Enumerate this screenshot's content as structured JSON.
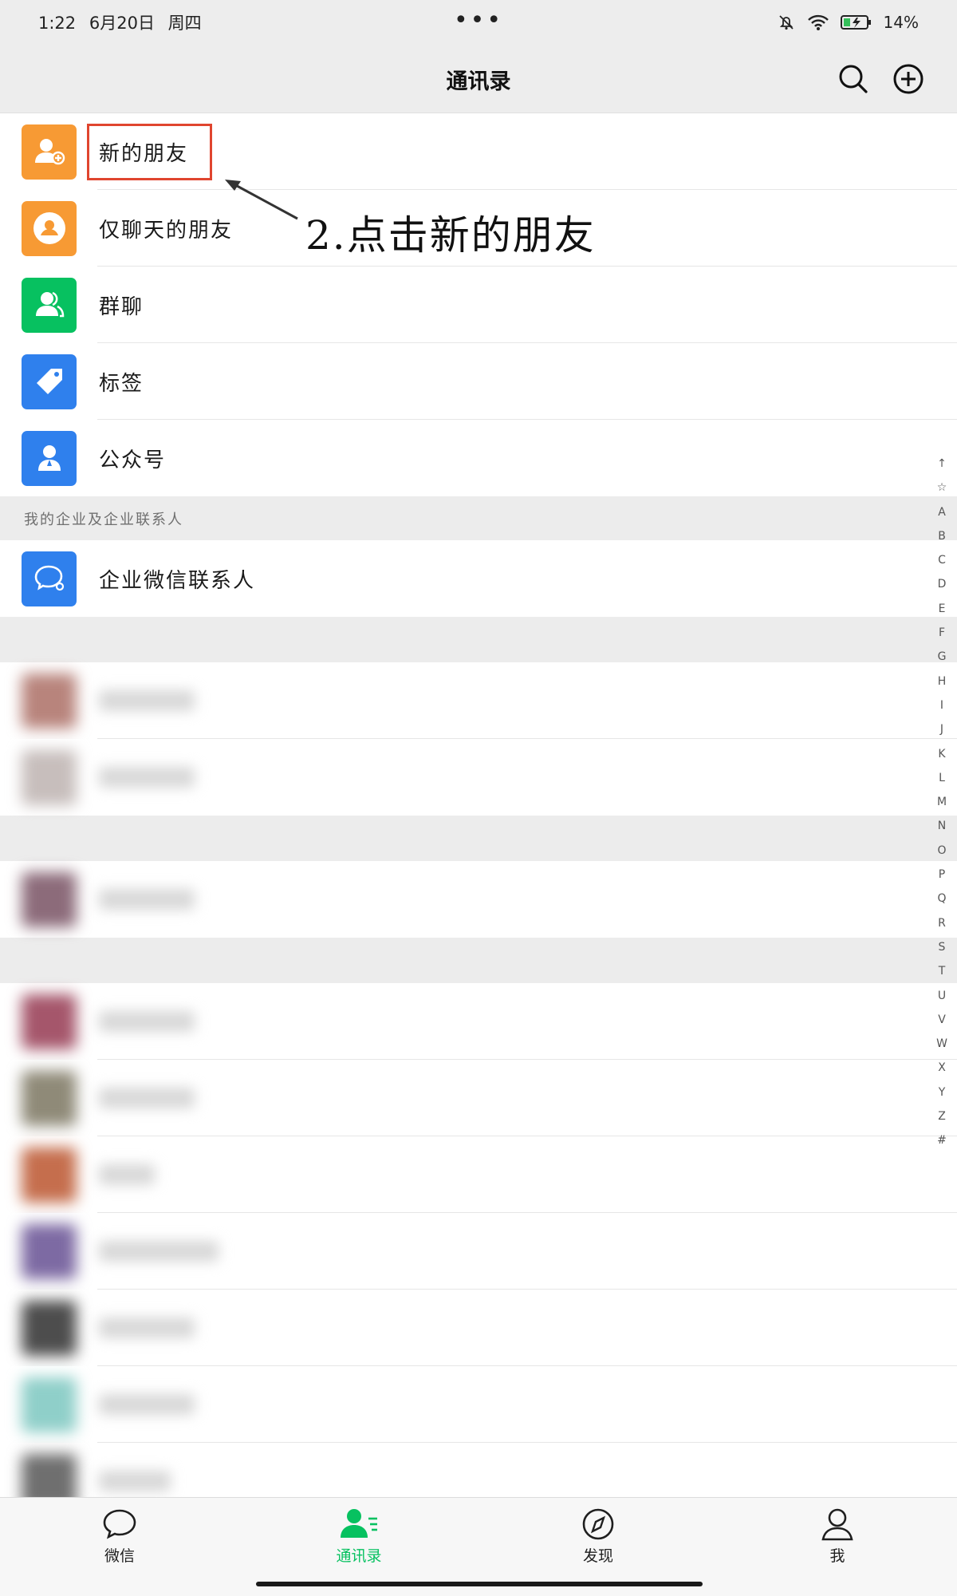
{
  "status_bar": {
    "time": "1:22",
    "date": "6月20日",
    "weekday": "周四",
    "battery": "14%",
    "dots": "•••"
  },
  "header": {
    "title": "通讯录"
  },
  "menu_items": [
    {
      "label": "新的朋友",
      "color": "#f79a34",
      "icon": "person-plus-icon"
    },
    {
      "label": "仅聊天的朋友",
      "color": "#f79a34",
      "icon": "chat-bubble-icon"
    },
    {
      "label": "群聊",
      "color": "#07c160",
      "icon": "group-icon"
    },
    {
      "label": "标签",
      "color": "#2f80ed",
      "icon": "tag-icon"
    },
    {
      "label": "公众号",
      "color": "#2f80ed",
      "icon": "person-icon"
    }
  ],
  "section": {
    "enterprise_header": "我的企业及企业联系人",
    "enterprise_item": "企业微信联系人",
    "enterprise_color": "#2f80ed"
  },
  "blurred_contact_colors": [
    "#b8847c",
    "#c7bebc",
    "#8c6b7a",
    "#a5566b",
    "#8f8a78",
    "#c56e4d",
    "#7d6aa3",
    "#4d4d4d",
    "#8fcfc9",
    "#6f6f6f"
  ],
  "annotation": {
    "text": "2.点击新的朋友"
  },
  "index_letters": [
    "↑",
    "☆",
    "A",
    "B",
    "C",
    "D",
    "E",
    "F",
    "G",
    "H",
    "I",
    "J",
    "K",
    "L",
    "M",
    "N",
    "O",
    "P",
    "Q",
    "R",
    "S",
    "T",
    "U",
    "V",
    "W",
    "X",
    "Y",
    "Z",
    "#"
  ],
  "tabbar": {
    "tabs": [
      {
        "label": "微信",
        "icon": "chat-icon"
      },
      {
        "label": "通讯录",
        "icon": "contacts-icon",
        "active": true
      },
      {
        "label": "发现",
        "icon": "compass-icon"
      },
      {
        "label": "我",
        "icon": "me-icon"
      }
    ],
    "active_color": "#07c160"
  }
}
